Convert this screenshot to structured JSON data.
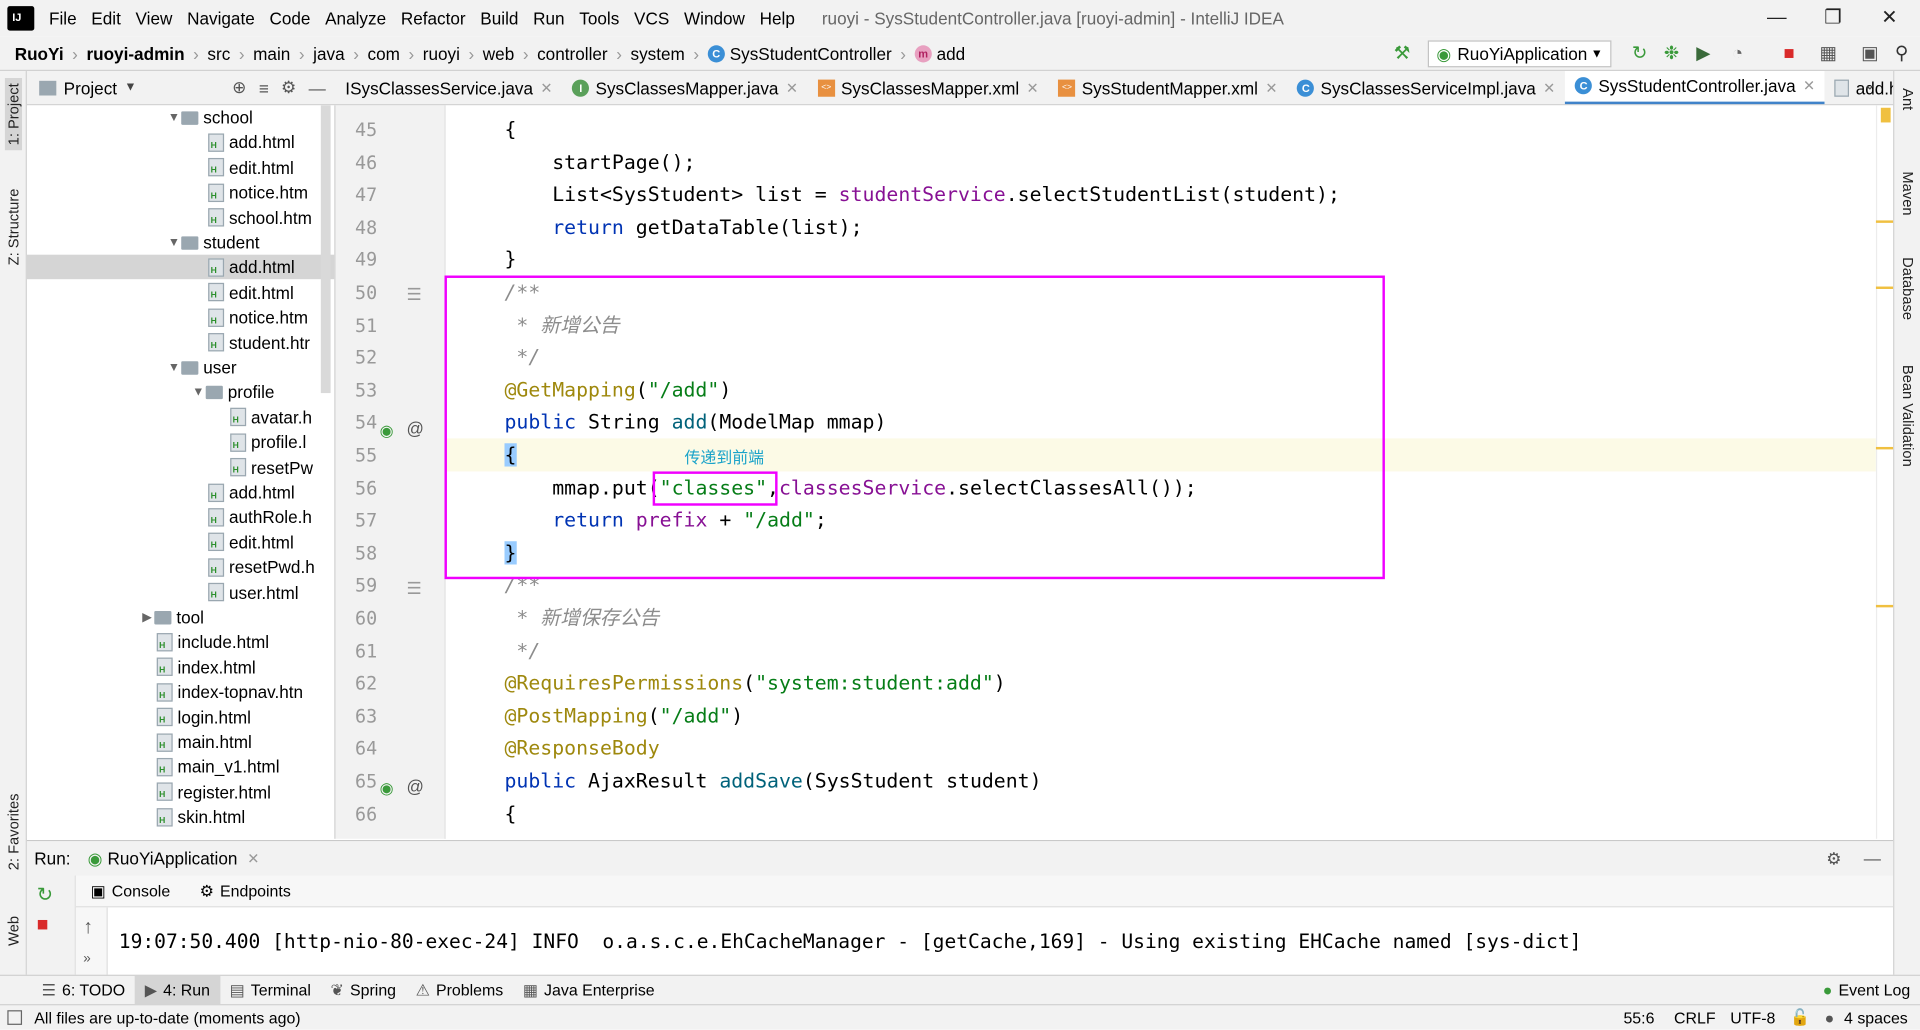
{
  "window": {
    "title": "ruoyi - SysStudentController.java [ruoyi-admin] - IntelliJ IDEA"
  },
  "menu": [
    "File",
    "Edit",
    "View",
    "Navigate",
    "Code",
    "Analyze",
    "Refactor",
    "Build",
    "Run",
    "Tools",
    "VCS",
    "Window",
    "Help"
  ],
  "breadcrumb": [
    "RuoYi",
    "ruoyi-admin",
    "src",
    "main",
    "java",
    "com",
    "ruoyi",
    "web",
    "controller",
    "system",
    "SysStudentController",
    "add"
  ],
  "toolbar": {
    "run_config": "RuoYiApplication"
  },
  "left_strip": {
    "project": "1: Project",
    "structure": "Z: Structure",
    "favorites": "2: Favorites",
    "web": "Web"
  },
  "right_strip": {
    "ant": "Ant",
    "maven": "Maven",
    "database": "Database",
    "bean_validation": "Bean Validation"
  },
  "project_panel": {
    "title": "Project"
  },
  "tree": [
    {
      "label": "school",
      "type": "folder",
      "depth": 2,
      "expanded": true
    },
    {
      "label": "add.html",
      "type": "file",
      "depth": 3
    },
    {
      "label": "edit.html",
      "type": "file",
      "depth": 3
    },
    {
      "label": "notice.htm",
      "type": "file",
      "depth": 3
    },
    {
      "label": "school.htm",
      "type": "file",
      "depth": 3
    },
    {
      "label": "student",
      "type": "folder",
      "depth": 2,
      "expanded": true
    },
    {
      "label": "add.html",
      "type": "file",
      "depth": 3,
      "selected": true
    },
    {
      "label": "edit.html",
      "type": "file",
      "depth": 3
    },
    {
      "label": "notice.htm",
      "type": "file",
      "depth": 3
    },
    {
      "label": "student.htr",
      "type": "file",
      "depth": 3
    },
    {
      "label": "user",
      "type": "folder",
      "depth": 2,
      "expanded": true
    },
    {
      "label": "profile",
      "type": "folder",
      "depth": 3,
      "expanded": true
    },
    {
      "label": "avatar.h",
      "type": "file",
      "depth": 4
    },
    {
      "label": "profile.l",
      "type": "file",
      "depth": 4
    },
    {
      "label": "resetPw",
      "type": "file",
      "depth": 4
    },
    {
      "label": "add.html",
      "type": "file",
      "depth": 3
    },
    {
      "label": "authRole.h",
      "type": "file",
      "depth": 3
    },
    {
      "label": "edit.html",
      "type": "file",
      "depth": 3
    },
    {
      "label": "resetPwd.h",
      "type": "file",
      "depth": 3
    },
    {
      "label": "user.html",
      "type": "file",
      "depth": 3
    },
    {
      "label": "tool",
      "type": "folder",
      "depth": 1,
      "expanded": false
    },
    {
      "label": "include.html",
      "type": "file",
      "depth": 1
    },
    {
      "label": "index.html",
      "type": "file",
      "depth": 1
    },
    {
      "label": "index-topnav.htn",
      "type": "file",
      "depth": 1
    },
    {
      "label": "login.html",
      "type": "file",
      "depth": 1
    },
    {
      "label": "main.html",
      "type": "file",
      "depth": 1
    },
    {
      "label": "main_v1.html",
      "type": "file",
      "depth": 1
    },
    {
      "label": "register.html",
      "type": "file",
      "depth": 1
    },
    {
      "label": "skin.html",
      "type": "file",
      "depth": 1
    }
  ],
  "tabs": [
    {
      "label": "ISysClassesService.java",
      "icon": "none"
    },
    {
      "label": "SysClassesMapper.java",
      "icon": "interface"
    },
    {
      "label": "SysClassesMapper.xml",
      "icon": "xml"
    },
    {
      "label": "SysStudentMapper.xml",
      "icon": "xml"
    },
    {
      "label": "SysClassesServiceImpl.java",
      "icon": "class"
    },
    {
      "label": "SysStudentController.java",
      "icon": "class",
      "active": true
    },
    {
      "label": "add.html",
      "icon": "html"
    }
  ],
  "editor": {
    "line_numbers": [
      "45",
      "46",
      "47",
      "48",
      "49",
      "50",
      "51",
      "52",
      "53",
      "54",
      "55",
      "56",
      "57",
      "58",
      "59",
      "60",
      "61",
      "62",
      "63",
      "64",
      "65",
      "66"
    ],
    "lines": [
      [
        {
          "t": "{",
          "c": ""
        }
      ],
      [
        {
          "t": "    startPage();",
          "c": ""
        }
      ],
      [
        {
          "t": "    List<SysStudent> list = ",
          "c": ""
        },
        {
          "t": "studentService",
          "c": "fld"
        },
        {
          "t": ".selectStudentList(student);",
          "c": ""
        }
      ],
      [
        {
          "t": "    ",
          "c": ""
        },
        {
          "t": "return",
          "c": "kw"
        },
        {
          "t": " getDataTable(list);",
          "c": ""
        }
      ],
      [
        {
          "t": "}",
          "c": ""
        }
      ],
      [
        {
          "t": "/**",
          "c": "cmt"
        }
      ],
      [
        {
          "t": " * 新增公告",
          "c": "cmt"
        }
      ],
      [
        {
          "t": " */",
          "c": "cmt"
        }
      ],
      [
        {
          "t": "@GetMapping",
          "c": "ann"
        },
        {
          "t": "(",
          "c": ""
        },
        {
          "t": "\"/add\"",
          "c": "str"
        },
        {
          "t": ")",
          "c": ""
        }
      ],
      [
        {
          "t": "public",
          "c": "kw"
        },
        {
          "t": " String ",
          "c": ""
        },
        {
          "t": "add",
          "c": "mth"
        },
        {
          "t": "(ModelMap mmap)",
          "c": ""
        }
      ],
      [
        {
          "t": "{",
          "c": "brace"
        }
      ],
      [
        {
          "t": "    mmap.put(",
          "c": ""
        },
        {
          "t": "\"classes\"",
          "c": "str"
        },
        {
          "t": ",",
          "c": ""
        },
        {
          "t": "classesService",
          "c": "fld"
        },
        {
          "t": ".selectClassesAll());",
          "c": ""
        }
      ],
      [
        {
          "t": "    ",
          "c": ""
        },
        {
          "t": "return",
          "c": "kw"
        },
        {
          "t": " ",
          "c": ""
        },
        {
          "t": "prefix",
          "c": "fld"
        },
        {
          "t": " + ",
          "c": ""
        },
        {
          "t": "\"/add\"",
          "c": "str"
        },
        {
          "t": ";",
          "c": ""
        }
      ],
      [
        {
          "t": "}",
          "c": "brace"
        }
      ],
      [
        {
          "t": "/**",
          "c": "cmt"
        }
      ],
      [
        {
          "t": " * 新增保存公告",
          "c": "cmt"
        }
      ],
      [
        {
          "t": " */",
          "c": "cmt"
        }
      ],
      [
        {
          "t": "@RequiresPermissions",
          "c": "ann"
        },
        {
          "t": "(",
          "c": ""
        },
        {
          "t": "\"system:student:add\"",
          "c": "str"
        },
        {
          "t": ")",
          "c": ""
        }
      ],
      [
        {
          "t": "@PostMapping",
          "c": "ann"
        },
        {
          "t": "(",
          "c": ""
        },
        {
          "t": "\"/add\"",
          "c": "str"
        },
        {
          "t": ")",
          "c": ""
        }
      ],
      [
        {
          "t": "@ResponseBody",
          "c": "ann"
        }
      ],
      [
        {
          "t": "public",
          "c": "kw"
        },
        {
          "t": " AjaxResult ",
          "c": ""
        },
        {
          "t": "addSave",
          "c": "mth"
        },
        {
          "t": "(SysStudent student)",
          "c": ""
        }
      ],
      [
        {
          "t": "{",
          "c": ""
        }
      ]
    ],
    "annotation_note": "传递到前端"
  },
  "run_panel": {
    "label": "Run:",
    "config": "RuoYiApplication",
    "subtabs": [
      "Console",
      "Endpoints"
    ],
    "console_lines": [
      "19:07:50.400 [http-nio-80-exec-24] INFO  o.a.s.c.e.EhCacheManager - [getCache,169] - Using existing EHCache named [sys-dict]"
    ]
  },
  "bottom_tabs": [
    "6: TODO",
    "4: Run",
    "Terminal",
    "Spring",
    "Problems",
    "Java Enterprise",
    "Event Log"
  ],
  "status": {
    "message": "All files are up-to-date (moments ago)",
    "position": "55:6",
    "line_sep": "CRLF",
    "encoding": "UTF-8",
    "indent": "4 spaces"
  }
}
